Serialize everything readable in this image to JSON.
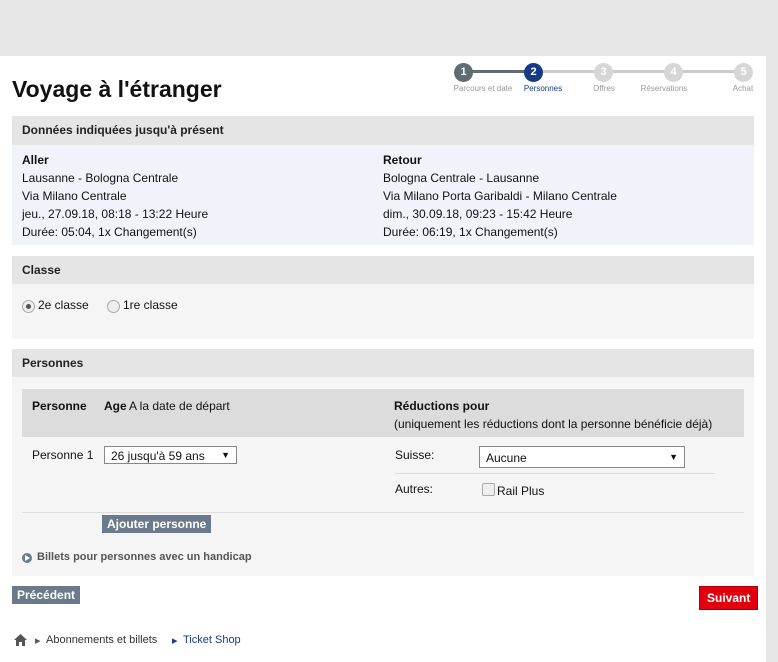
{
  "title": "Voyage à l'étranger",
  "stepper": [
    {
      "num": "1",
      "label": "Parcours et date",
      "state": "done"
    },
    {
      "num": "2",
      "label": "Personnes",
      "state": "active"
    },
    {
      "num": "3",
      "label": "Offres",
      "state": "todo"
    },
    {
      "num": "4",
      "label": "Réservations",
      "state": "todo"
    },
    {
      "num": "5",
      "label": "Achat",
      "state": "todo"
    }
  ],
  "summary": {
    "header": "Données indiquées jusqu'à présent",
    "outbound": {
      "heading": "Aller",
      "route": "Lausanne - Bologna Centrale",
      "via": "Via Milano Centrale",
      "datetime": "jeu., 27.09.18, 08:18 - 13:22 Heure",
      "duration": "Durée: 05:04, 1x Changement(s)"
    },
    "return": {
      "heading": "Retour",
      "route": "Bologna Centrale - Lausanne",
      "via": "Via Milano Porta Garibaldi - Milano Centrale",
      "datetime": "dim., 30.09.18, 09:23 - 15:42 Heure",
      "duration": "Durée: 06:19, 1x Changement(s)"
    }
  },
  "class": {
    "header": "Classe",
    "options": [
      {
        "label": "2e classe",
        "checked": true
      },
      {
        "label": "1re classe",
        "checked": false
      }
    ]
  },
  "persons": {
    "header": "Personnes",
    "col_person": "Personne",
    "col_age": "Age",
    "col_age_note": "A la date de départ",
    "col_reductions": "Réductions pour",
    "col_reductions_note": "(uniquement les réductions dont la personne bénéficie déjà)",
    "rows": [
      {
        "label": "Personne 1",
        "age_value": "26 jusqu'à  59 ans",
        "suisse_label": "Suisse:",
        "suisse_value": "Aucune",
        "autres_label": "Autres:",
        "rail_plus_label": "Rail Plus"
      }
    ],
    "add_button": "Ajouter personne",
    "handicap_link": "Billets pour personnes avec un handicap"
  },
  "nav": {
    "prev": "Précédent",
    "next": "Suivant"
  },
  "breadcrumb": {
    "items": [
      "Abonnements et billets",
      "Ticket Shop"
    ]
  },
  "colors": {
    "active_step": "#173a84",
    "done_step": "#5f6b75",
    "todo_step": "#cccccc",
    "next_button": "#e0000e"
  }
}
